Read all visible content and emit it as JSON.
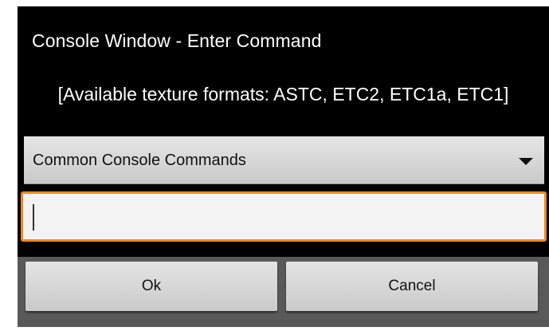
{
  "dialog": {
    "title": "Console Window - Enter Command",
    "message": "[Available texture formats: ASTC, ETC2, ETC1a, ETC1]",
    "dropdown": {
      "selected": "Common Console Commands",
      "icon": "caret-down-icon"
    },
    "command_input": {
      "value": "",
      "placeholder": "",
      "focused": true
    },
    "buttons": {
      "ok_label": "Ok",
      "cancel_label": "Cancel"
    }
  },
  "colors": {
    "dialog_background": "#000000",
    "input_focus_border": "#f08a1c",
    "button_bar": "#595959"
  }
}
